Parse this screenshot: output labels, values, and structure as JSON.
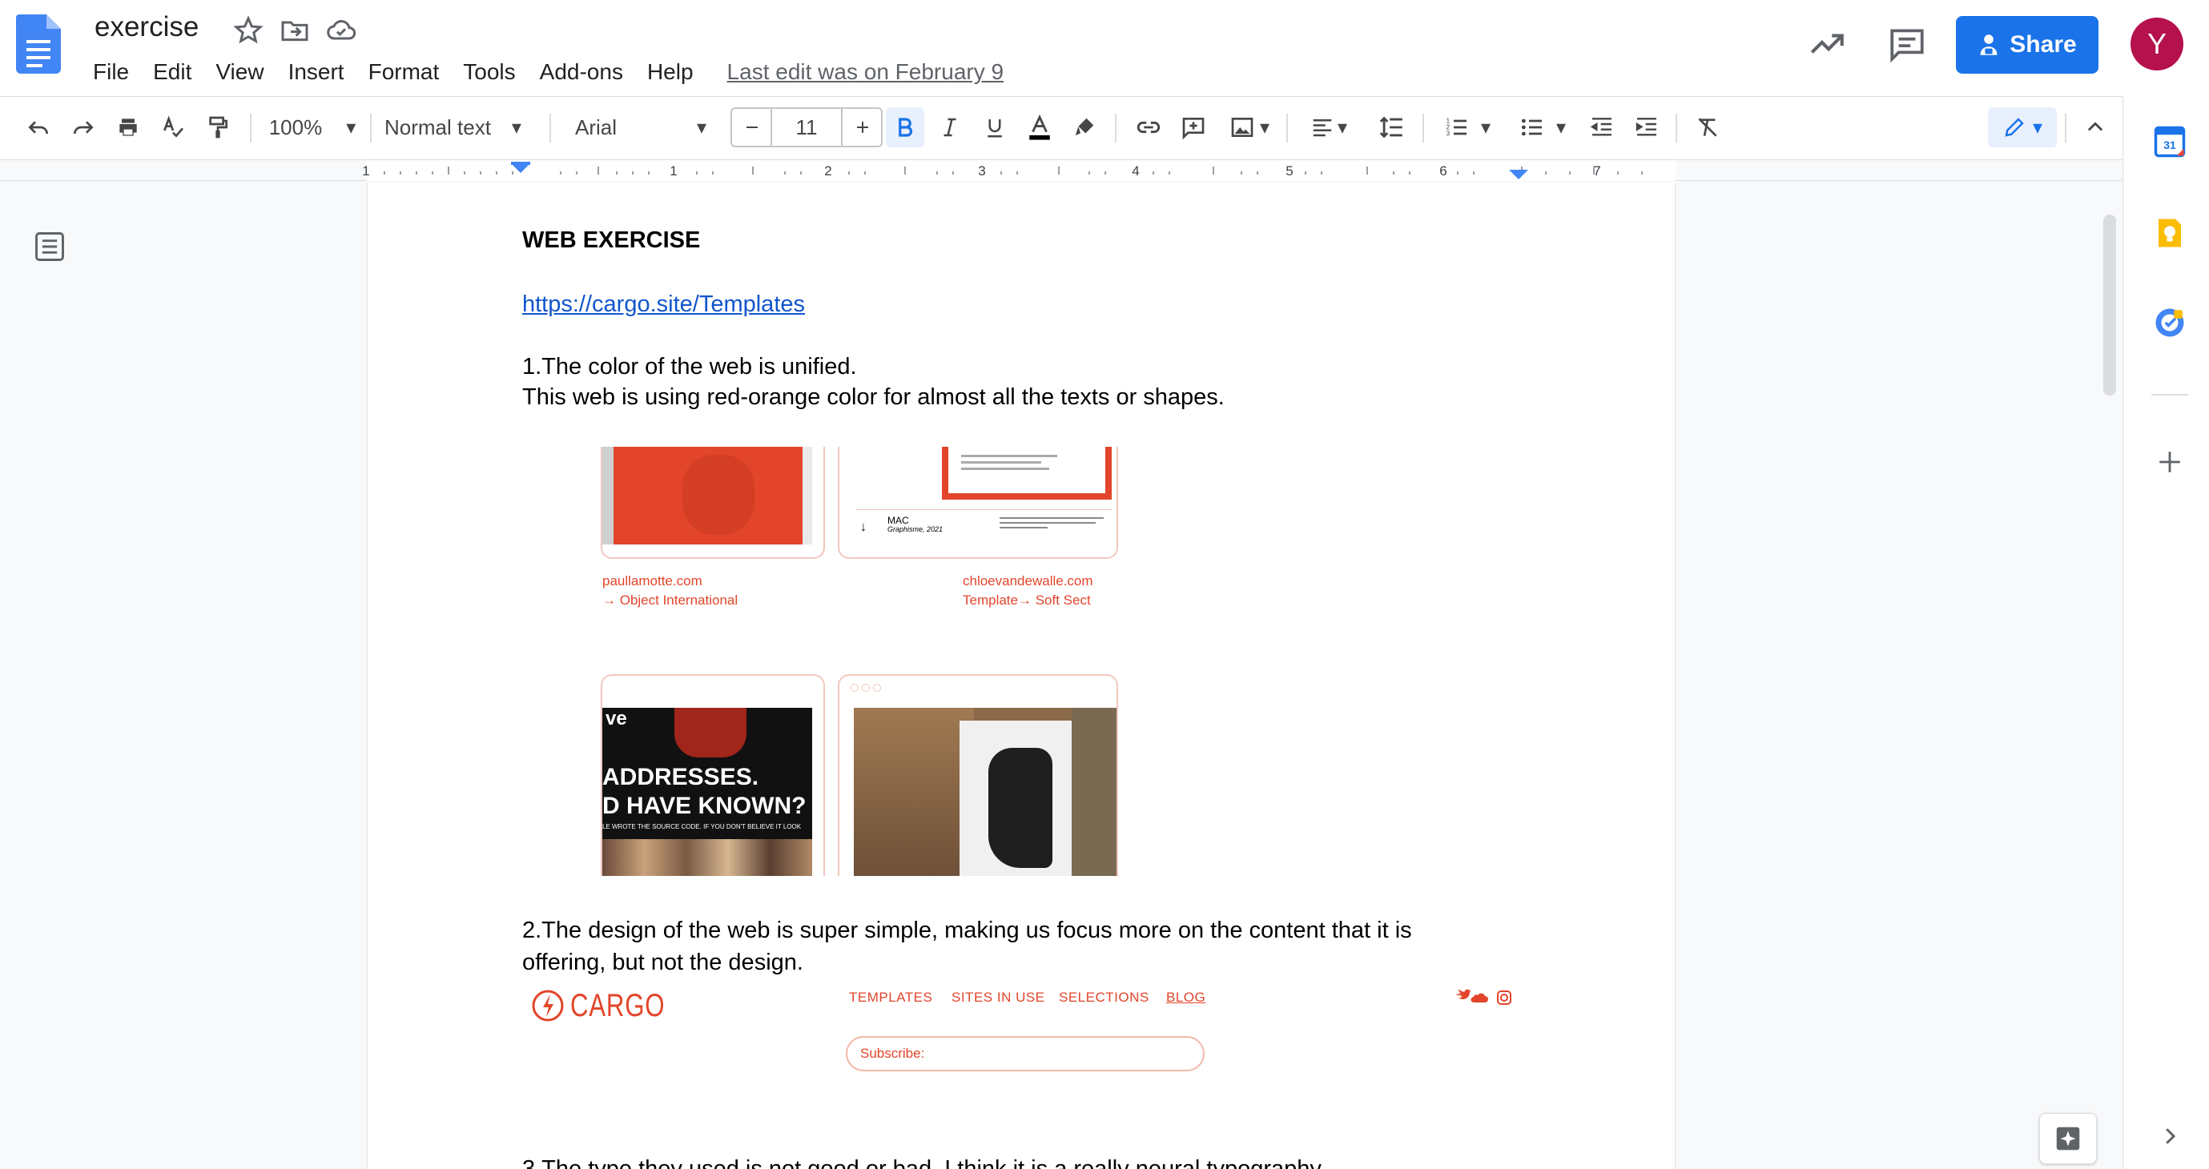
{
  "header": {
    "doc_title": "exercise",
    "last_edit": "Last edit was on February 9",
    "share_label": "Share",
    "avatar_letter": "Y"
  },
  "menu": [
    "File",
    "Edit",
    "View",
    "Insert",
    "Format",
    "Tools",
    "Add-ons",
    "Help"
  ],
  "toolbar": {
    "zoom": "100%",
    "style": "Normal text",
    "font": "Arial",
    "font_size": "11"
  },
  "ruler": {
    "labels": [
      "1",
      "1",
      "2",
      "3",
      "4",
      "5",
      "6",
      "7"
    ]
  },
  "document": {
    "heading": "WEB EXERCISE",
    "link": "https://cargo.site/Templates",
    "p1_line1": "1.The color of the web is unified.",
    "p1_line2": "This web is using red-orange color for almost all the texts or shapes.",
    "p2_line1": "2.The design of the web is super simple, making us focus more on the content that it is",
    "p2_line2": "offering, but not the design.",
    "p3_partial": "3.The type they used is not good or bad. I think it is a really neural typography."
  },
  "screenshot1": {
    "caption_left_1": "paullamotte.com",
    "caption_left_2": "→ Object International",
    "caption_right_1": "chloevandewalle.com",
    "caption_right_2": "Template→ Soft Sect",
    "mac_label": "MAC",
    "mac_sub": "Graphisme, 2021",
    "bottom_left_lines": [
      "ve",
      "ADDRESSES.",
      "D HAVE KNOWN?",
      "LE WROTE THE SOURCE CODE. IF YOU DON'T BELIEVE IT LOOK"
    ]
  },
  "screenshot2": {
    "logo": "CARGO",
    "nav": [
      "TEMPLATES",
      "SITES IN USE",
      "SELECTIONS",
      "BLOG"
    ],
    "subscribe": "Subscribe:"
  },
  "colors": {
    "accent_blue": "#1a73e8",
    "cargo_red": "#e2452a",
    "avatar_bg": "#b5114c"
  },
  "icons": [
    "docs-logo-icon",
    "star-icon",
    "move-folder-icon",
    "cloud-saved-icon",
    "activity-trend-icon",
    "comments-icon",
    "share-person-icon",
    "undo-icon",
    "redo-icon",
    "print-icon",
    "spellcheck-icon",
    "paint-format-icon",
    "bold-icon",
    "italic-icon",
    "underline-icon",
    "text-color-icon",
    "highlight-icon",
    "link-icon",
    "add-comment-icon",
    "insert-image-icon",
    "align-icon",
    "line-spacing-icon",
    "numbered-list-icon",
    "bulleted-list-icon",
    "decrease-indent-icon",
    "increase-indent-icon",
    "clear-formatting-icon",
    "edit-mode-icon",
    "collapse-icon",
    "outline-icon",
    "calendar-icon",
    "keep-icon",
    "tasks-icon",
    "add-icon",
    "expand-panel-icon",
    "explore-icon"
  ]
}
